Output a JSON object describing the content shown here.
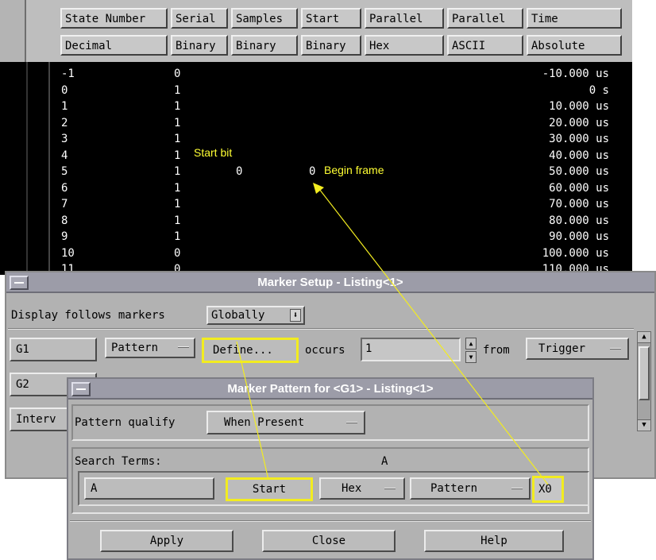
{
  "listing": {
    "columns": [
      {
        "name": "State Number",
        "format": "Decimal"
      },
      {
        "name": "Serial",
        "format": "Binary"
      },
      {
        "name": "Samples",
        "format": "Binary"
      },
      {
        "name": "Start",
        "format": "Binary"
      },
      {
        "name": "Parallel",
        "format": "Hex"
      },
      {
        "name": "Parallel",
        "format": "ASCII"
      },
      {
        "name": "Time",
        "format": "Absolute"
      }
    ],
    "rows": [
      {
        "state": "-1",
        "serial": "0",
        "time": "-10.000 us"
      },
      {
        "state": "0",
        "serial": "1",
        "time": "0 s"
      },
      {
        "state": "1",
        "serial": "1",
        "time": "10.000 us"
      },
      {
        "state": "2",
        "serial": "1",
        "time": "20.000 us"
      },
      {
        "state": "3",
        "serial": "1",
        "time": "30.000 us"
      },
      {
        "state": "4",
        "serial": "1",
        "time": "40.000 us"
      },
      {
        "state": "5",
        "serial": "1",
        "start": "0",
        "parallel_hex": "0",
        "time": "50.000 us"
      },
      {
        "state": "6",
        "serial": "1",
        "time": "60.000 us"
      },
      {
        "state": "7",
        "serial": "1",
        "time": "70.000 us"
      },
      {
        "state": "8",
        "serial": "1",
        "time": "80.000 us"
      },
      {
        "state": "9",
        "serial": "1",
        "time": "90.000 us"
      },
      {
        "state": "10",
        "serial": "0",
        "time": "100.000 us"
      },
      {
        "state": "11",
        "serial": "0",
        "time": "110.000 us"
      }
    ],
    "annotations": {
      "start_bit": "Start bit",
      "begin_frame": "Begin frame"
    }
  },
  "marker_setup": {
    "title": "Marker Setup - Listing<1>",
    "display_follows_label": "Display follows markers",
    "display_follows_value": "Globally",
    "markers": [
      {
        "name": "G1",
        "mode": "Pattern",
        "define": "Define...",
        "occurs_label": "occurs",
        "occurs_value": "1",
        "from_label": "from",
        "from_value": "Trigger"
      },
      {
        "name": "G2"
      },
      {
        "name": "Interv"
      }
    ]
  },
  "marker_pattern": {
    "title": "Marker Pattern for <G1> - Listing<1>",
    "qualify_label": "Pattern qualify",
    "qualify_value": "When Present",
    "search_terms_label": "Search Terms:",
    "search_terms_value": "A",
    "term": {
      "name": "A",
      "label": "Start",
      "base": "Hex",
      "type": "Pattern",
      "value": "X0"
    },
    "buttons": {
      "apply": "Apply",
      "close": "Close",
      "help": "Help"
    }
  },
  "colors": {
    "highlight": "#f2ec20",
    "listing_bg": "#000000",
    "annotation": "#ffff33"
  }
}
